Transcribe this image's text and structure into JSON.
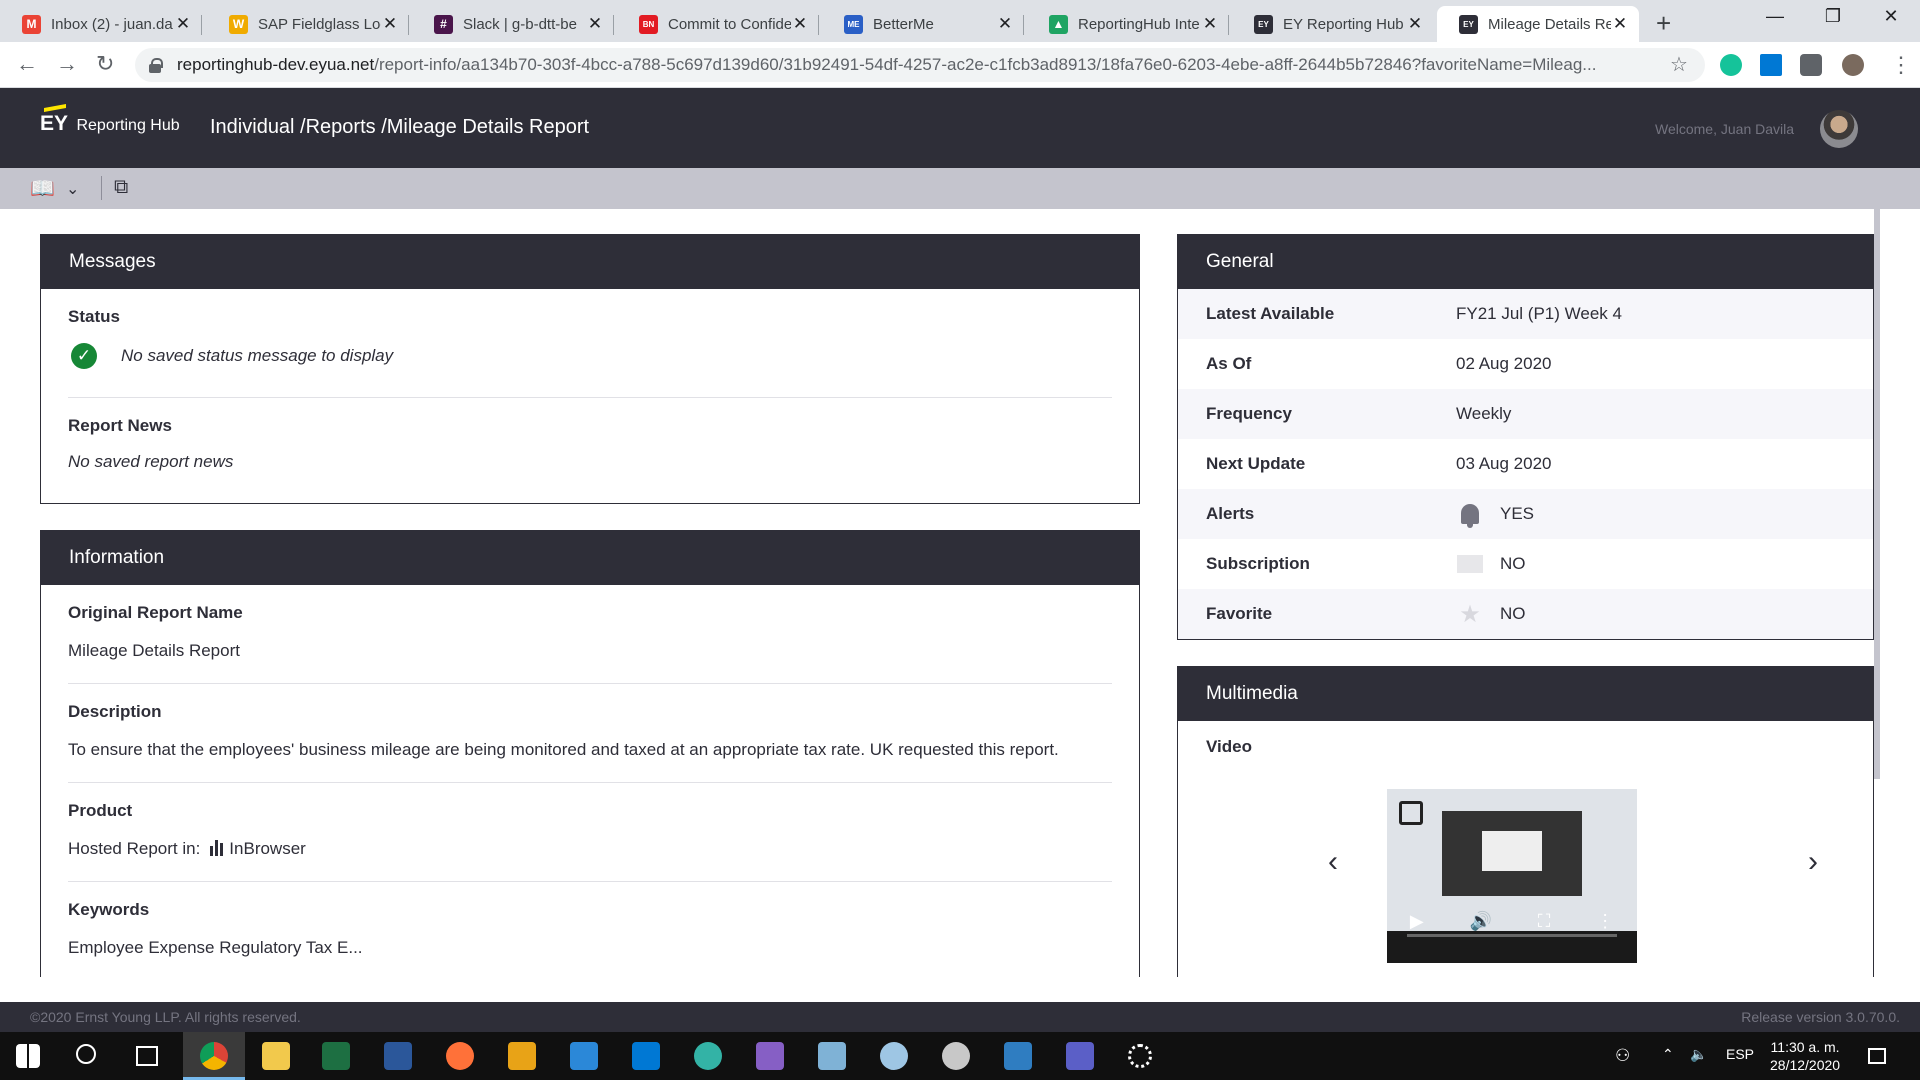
{
  "browser": {
    "tabs": [
      {
        "title": "Inbox (2) - juan.da",
        "favicon": "gmail-icon",
        "color": "#ea4335",
        "glyph": "M"
      },
      {
        "title": "SAP Fieldglass Log",
        "favicon": "fieldglass-icon",
        "color": "#f0ab00",
        "glyph": "W"
      },
      {
        "title": "Slack | g-b-dtt-be",
        "favicon": "slack-icon",
        "color": "#4a154b",
        "glyph": "#"
      },
      {
        "title": "Commit to Confide",
        "favicon": "bnsk-icon",
        "color": "#e21b23",
        "glyph": "BN"
      },
      {
        "title": "BetterMe",
        "favicon": "betterme-icon",
        "color": "#2a5fc6",
        "glyph": "ME"
      },
      {
        "title": "ReportingHub Inte",
        "favicon": "google-drive-icon",
        "color": "#1fa463",
        "glyph": "▲"
      },
      {
        "title": "EY Reporting Hub",
        "favicon": "ey-icon",
        "color": "#2e2e38",
        "glyph": "EY"
      },
      {
        "title": "Mileage Details Re",
        "favicon": "ey-icon",
        "color": "#2e2e38",
        "glyph": "EY"
      }
    ],
    "active_tab": 7,
    "url_host": "reportinghub-dev.eyua.net",
    "url_path": "/report-info/aa134b70-303f-4bcc-a788-5c697d139d60/31b92491-54df-4257-ac2e-c1fcb3ad8913/18fa76e0-6203-4ebe-a8ff-2644b5b72846?favoriteName=Mileag..."
  },
  "app": {
    "logo_ey": "EY",
    "logo_text": "Reporting Hub",
    "breadcrumb": "Individual /Reports /Mileage Details Report",
    "welcome": "Welcome, Juan Davila"
  },
  "messages": {
    "title": "Messages",
    "status_label": "Status",
    "status_text": "No saved status message to display",
    "news_label": "Report News",
    "news_text": "No saved report news"
  },
  "information": {
    "title": "Information",
    "original_name_label": "Original Report Name",
    "original_name": "Mileage Details Report",
    "description_label": "Description",
    "description": "To ensure that the employees' business mileage are being monitored and taxed at an appropriate tax rate. UK requested this report.",
    "product_label": "Product",
    "product_prefix": "Hosted Report in:",
    "product_value": "InBrowser",
    "keywords_label": "Keywords",
    "keywords": "Employee Expense Regulatory Tax E..."
  },
  "general": {
    "title": "General",
    "rows": [
      {
        "key": "Latest Available",
        "value": "FY21 Jul (P1) Week 4"
      },
      {
        "key": "As Of",
        "value": "02 Aug 2020"
      },
      {
        "key": "Frequency",
        "value": "Weekly"
      },
      {
        "key": "Next Update",
        "value": "03 Aug 2020"
      },
      {
        "key": "Alerts",
        "value": "YES",
        "icon": "bell-icon"
      },
      {
        "key": "Subscription",
        "value": "NO",
        "icon": "mail-icon"
      },
      {
        "key": "Favorite",
        "value": "NO",
        "icon": "star-icon"
      }
    ]
  },
  "multimedia": {
    "title": "Multimedia",
    "video_label": "Video"
  },
  "footer": {
    "copyright": "©2020 Ernst Young LLP. All rights reserved.",
    "release": "Release version 3.0.70.0."
  },
  "taskbar": {
    "language": "ESP",
    "time": "11:30 a. m.",
    "date": "28/12/2020"
  }
}
